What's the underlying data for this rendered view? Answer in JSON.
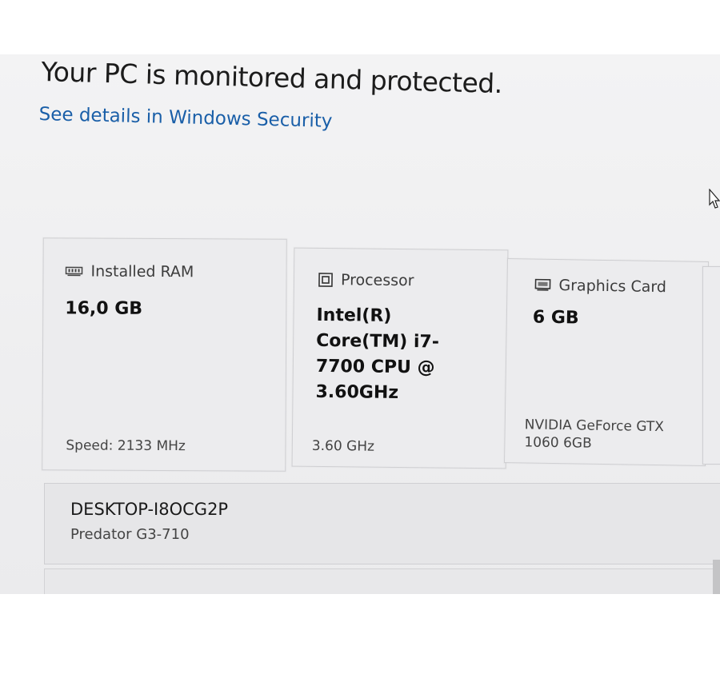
{
  "security": {
    "status_text": "Your PC is monitored and protected.",
    "link_text": "See details in Windows Security"
  },
  "specs": {
    "ram": {
      "icon": "memory-icon",
      "label": "Installed RAM",
      "value": "16,0 GB",
      "footer": "Speed: 2133 MHz"
    },
    "processor": {
      "icon": "processor-icon",
      "label": "Processor",
      "value": "Intel(R) Core(TM) i7-7700 CPU @ 3.60GHz",
      "footer": "3.60 GHz"
    },
    "graphics": {
      "icon": "graphics-card-icon",
      "label": "Graphics Card",
      "value": "6 GB",
      "footer": "NVIDIA GeForce GTX 1060 6GB"
    }
  },
  "device": {
    "name": "DESKTOP-I8OCG2P",
    "model": "Predator G3-710"
  },
  "colors": {
    "link": "#1a5fa8",
    "card": "#ececee",
    "background": "#f3f3f4"
  }
}
